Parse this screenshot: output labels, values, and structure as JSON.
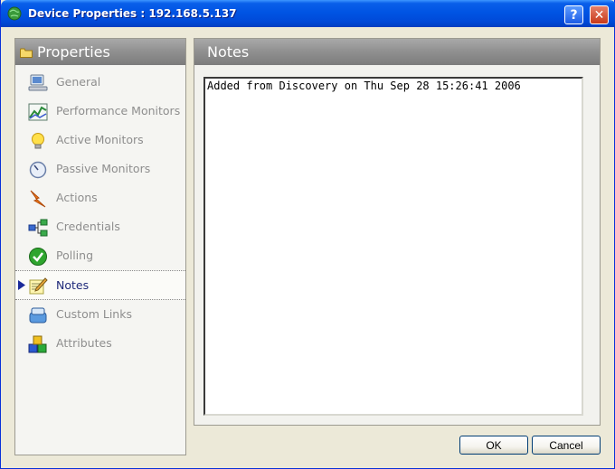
{
  "window": {
    "title": "Device Properties : 192.168.5.137",
    "help_label": "?",
    "close_label": "✕"
  },
  "sidebar": {
    "title": "Properties",
    "items": [
      {
        "label": "General",
        "icon": "computer-icon"
      },
      {
        "label": "Performance Monitors",
        "icon": "chart-icon"
      },
      {
        "label": "Active Monitors",
        "icon": "lightbulb-icon"
      },
      {
        "label": "Passive Monitors",
        "icon": "gauge-icon"
      },
      {
        "label": "Actions",
        "icon": "lightning-icon"
      },
      {
        "label": "Credentials",
        "icon": "network-icon"
      },
      {
        "label": "Polling",
        "icon": "checkmark-icon"
      },
      {
        "label": "Notes",
        "icon": "pencil-note-icon"
      },
      {
        "label": "Custom Links",
        "icon": "link-icon"
      },
      {
        "label": "Attributes",
        "icon": "blocks-icon"
      }
    ],
    "selected_index": 7
  },
  "main": {
    "title": "Notes",
    "notes_text": "Added from Discovery on Thu Sep 28 15:26:41 2006"
  },
  "footer": {
    "ok_label": "OK",
    "cancel_label": "Cancel"
  },
  "colors": {
    "titlebar": "#0054E3",
    "panel_header": "#8F8F8F",
    "window_bg": "#ECE9D8",
    "selected_text": "#1F2A7A"
  }
}
